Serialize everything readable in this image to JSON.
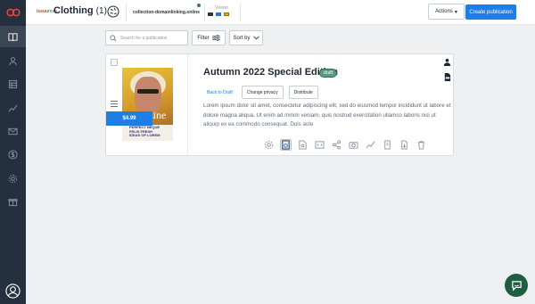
{
  "app": {
    "brand_main": "issuu",
    "brand_sub": "mag",
    "page_title": "Clothing",
    "title_count": "(1)",
    "domain": "collection-domainlinking.online",
    "viewer_label": "Viewer",
    "actions_label": "Actions",
    "create_label": "Create publication"
  },
  "sidebar": {
    "items": [
      {
        "icon": "book-icon",
        "active": true
      },
      {
        "icon": "users-icon",
        "active": false
      },
      {
        "icon": "table-icon",
        "active": false
      },
      {
        "icon": "chart-icon",
        "active": false
      },
      {
        "icon": "mail-icon",
        "active": false
      },
      {
        "icon": "dollar-icon",
        "active": false
      },
      {
        "icon": "settings-icon",
        "active": false
      },
      {
        "icon": "gift-icon",
        "active": false
      }
    ]
  },
  "filters": {
    "search_placeholder": "Search for a publication",
    "filter_label": "Filter",
    "sort_label": "Sort by"
  },
  "publication": {
    "title": "Autumn 2022 Special Edition",
    "badge": "draft",
    "price": "$4.99",
    "cover_title": "Magazine",
    "cover_copy_1": "PERFECT NEQUE",
    "cover_copy_2": "FELIS FRESH",
    "cover_copy_3": "IDEAS OF LOREM",
    "back_to_draft": "Back to Draft",
    "change_privacy": "Change privacy",
    "distribute": "Distribute",
    "description": "Lorem ipsum dolor sit amet, consectetur adipiscing elit, sed do eiusmod tempor incididunt ut labore et dolore magna aliqua. Ut enim ad minim veniam, quis nostrud exercitation ullamco laboris nisi ut aliquip ex ea commodo consequat. Duis aute"
  },
  "colors": {
    "primary": "#1e7ee4",
    "rail": "#24303d",
    "badge": "#5b9c83",
    "chat": "#1e5f3f"
  }
}
